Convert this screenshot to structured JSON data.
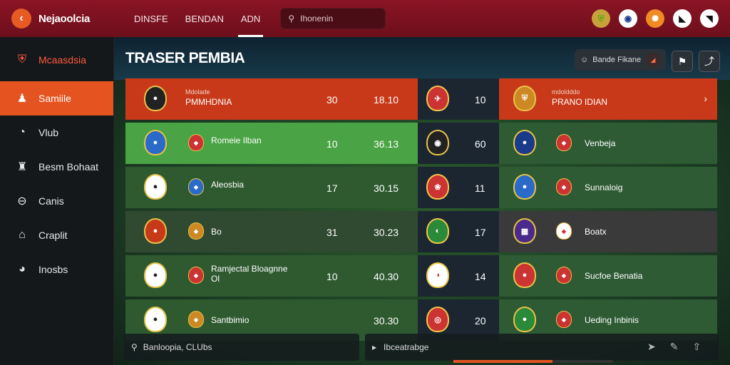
{
  "app": {
    "logo": "Nejaoolcia"
  },
  "nav": [
    "DINSFE",
    "BENDAN",
    "ADN"
  ],
  "search": {
    "placeholder": "Ihonenin"
  },
  "sidebar": [
    {
      "label": "Mcaasdsia",
      "icon": "shield-icon"
    },
    {
      "label": "Samiile",
      "icon": "person-icon"
    },
    {
      "label": "Vlub",
      "icon": "ball-icon"
    },
    {
      "label": "Besm Bohaat",
      "icon": "trophy-icon"
    },
    {
      "label": "Canis",
      "icon": "stadium-icon"
    },
    {
      "label": "Craplit",
      "icon": "chart-icon"
    },
    {
      "label": "Inosbs",
      "icon": "grid-icon"
    }
  ],
  "page": {
    "title": "TRASER PEMBIA"
  },
  "user_chip": {
    "label": "Bande Fikane"
  },
  "rows": [
    {
      "left_sub": "Mdolade",
      "left_name": "PMMHDNIA",
      "col1": "30",
      "col2": "18.10",
      "mid": "10",
      "right_sub": "mdoldddo",
      "right_name": "PRANO IDIAN"
    },
    {
      "left_name": "Romeie Ilban",
      "col1": "10",
      "col2": "36.13",
      "mid": "60",
      "right_name": "Venbeja"
    },
    {
      "left_name": "Aleosbia",
      "col1": "17",
      "col2": "30.15",
      "mid": "11",
      "right_name": "Sunnaloig"
    },
    {
      "left_name": "Bo",
      "col1": "31",
      "col2": "30.23",
      "mid": "17",
      "right_name": "Boatx"
    },
    {
      "left_name": "Ramjectal Bloagnne",
      "left_name2": "Ol",
      "col1": "10",
      "col2": "40.30",
      "mid": "14",
      "right_name": "Sucfoe Benatia"
    },
    {
      "left_name": "Santbimio",
      "col1": "",
      "col2": "30.30",
      "mid": "20",
      "right_name": "Ueding Inbinis"
    }
  ],
  "bottom": {
    "left_text": "Banloopia, CLUbs",
    "right_placeholder": "Ibceatrabge"
  },
  "progress": 0.62,
  "colors": {
    "accent": "#e55420",
    "topbar": "#8a1424",
    "green": "#4caf50"
  }
}
